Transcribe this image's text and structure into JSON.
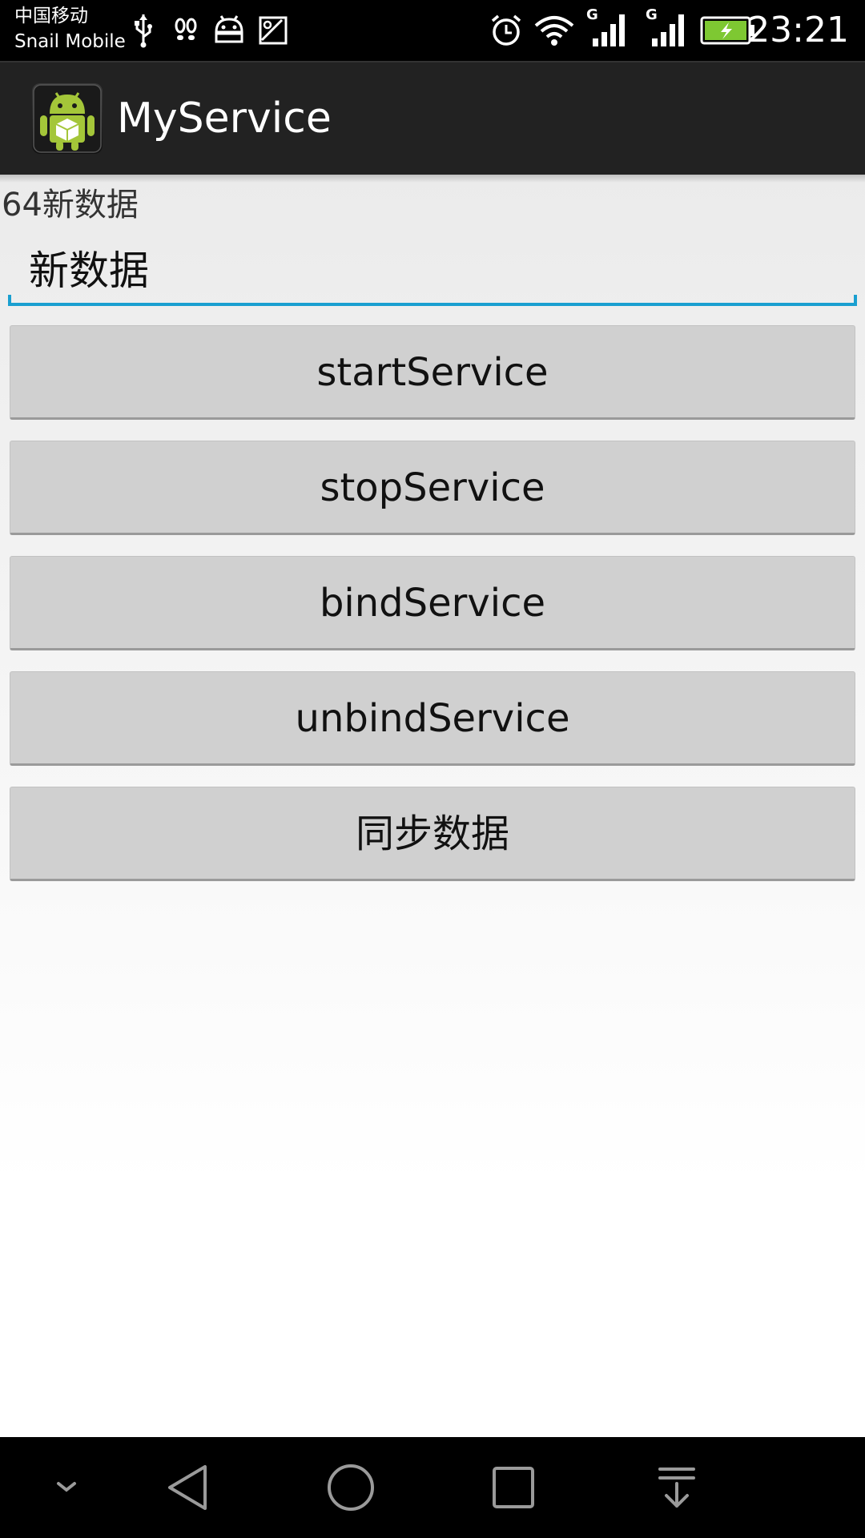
{
  "status_bar": {
    "carrier_line1": "中国移动",
    "carrier_line2": "Snail Mobile",
    "network_label_1": "G",
    "network_label_2": "G",
    "time": "23:21",
    "icons": [
      "usb-icon",
      "footprints-icon",
      "android-debug-icon",
      "image-icon",
      "alarm-icon",
      "wifi-icon",
      "signal-icon",
      "signal-icon",
      "battery-charging-icon"
    ]
  },
  "action_bar": {
    "title": "MyService",
    "icon": "android-app-icon"
  },
  "main": {
    "data_label": "64新数据",
    "input_value": "新数据",
    "buttons": [
      {
        "label": "startService"
      },
      {
        "label": "stopService"
      },
      {
        "label": "bindService"
      },
      {
        "label": "unbindService"
      },
      {
        "label": "同步数据"
      }
    ]
  },
  "nav_bar": {
    "icons": [
      "chevron-down-icon",
      "back-icon",
      "home-icon",
      "recents-icon",
      "notification-pull-icon"
    ]
  },
  "colors": {
    "accent": "#1a9fd0",
    "action_bar": "#222222",
    "button": "#d0d0d0",
    "android_green": "#a4c639"
  }
}
